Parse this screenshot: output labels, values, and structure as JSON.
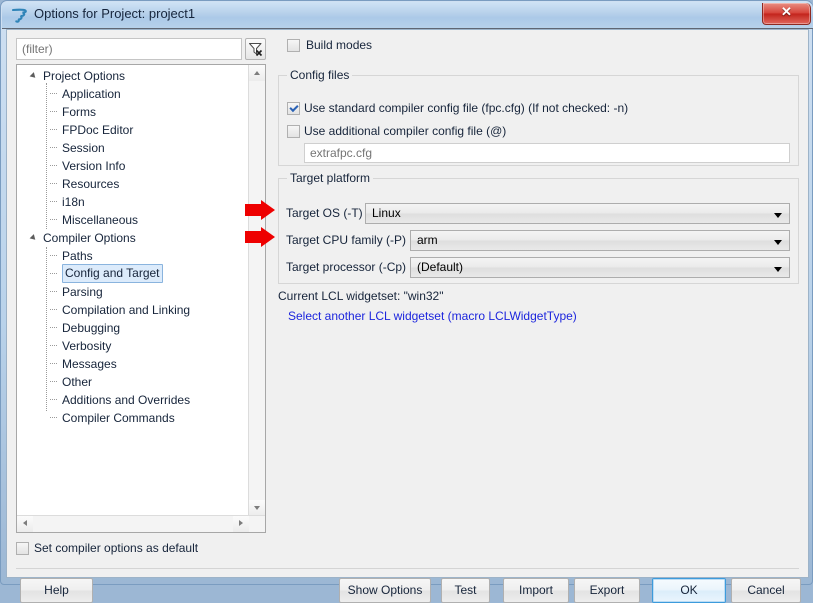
{
  "window": {
    "title": "Options for Project: project1",
    "app_icon": "lazarus-icon",
    "close_label": "✕"
  },
  "filter": {
    "placeholder": "(filter)",
    "value": "",
    "clear_icon": "filter-clear-icon"
  },
  "tree": {
    "items": [
      {
        "label": "Project Options",
        "level": 0,
        "expanded": true,
        "selected": false
      },
      {
        "label": "Application",
        "level": 1,
        "expanded": false,
        "selected": false
      },
      {
        "label": "Forms",
        "level": 1,
        "expanded": false,
        "selected": false
      },
      {
        "label": "FPDoc Editor",
        "level": 1,
        "expanded": false,
        "selected": false
      },
      {
        "label": "Session",
        "level": 1,
        "expanded": false,
        "selected": false
      },
      {
        "label": "Version Info",
        "level": 1,
        "expanded": false,
        "selected": false
      },
      {
        "label": "Resources",
        "level": 1,
        "expanded": false,
        "selected": false
      },
      {
        "label": "i18n",
        "level": 1,
        "expanded": false,
        "selected": false
      },
      {
        "label": "Miscellaneous",
        "level": 1,
        "expanded": false,
        "selected": false
      },
      {
        "label": "Compiler Options",
        "level": 0,
        "expanded": true,
        "selected": false
      },
      {
        "label": "Paths",
        "level": 1,
        "expanded": false,
        "selected": false
      },
      {
        "label": "Config and Target",
        "level": 1,
        "expanded": false,
        "selected": true
      },
      {
        "label": "Parsing",
        "level": 1,
        "expanded": false,
        "selected": false
      },
      {
        "label": "Compilation and Linking",
        "level": 1,
        "expanded": false,
        "selected": false
      },
      {
        "label": "Debugging",
        "level": 1,
        "expanded": false,
        "selected": false
      },
      {
        "label": "Verbosity",
        "level": 1,
        "expanded": false,
        "selected": false
      },
      {
        "label": "Messages",
        "level": 1,
        "expanded": false,
        "selected": false
      },
      {
        "label": "Other",
        "level": 1,
        "expanded": false,
        "selected": false
      },
      {
        "label": "Additions and Overrides",
        "level": 1,
        "expanded": false,
        "selected": false
      },
      {
        "label": "Compiler Commands",
        "level": 1,
        "expanded": false,
        "selected": false
      }
    ]
  },
  "main": {
    "build_modes": {
      "label": "Build modes",
      "checked": false
    },
    "config_files": {
      "title": "Config files",
      "use_standard": {
        "label": "Use standard compiler config file (fpc.cfg) (If not checked: -n)",
        "checked": true
      },
      "use_additional": {
        "label": "Use additional compiler config file (@)",
        "checked": false
      },
      "additional_path": {
        "value": "",
        "placeholder": "extrafpc.cfg"
      }
    },
    "target_platform": {
      "title": "Target platform",
      "target_os": {
        "label": "Target OS (-T)",
        "value": "Linux"
      },
      "target_cpu": {
        "label": "Target CPU family (-P)",
        "value": "arm"
      },
      "target_processor": {
        "label": "Target processor (-Cp)",
        "value": "(Default)"
      }
    },
    "widgetset": {
      "current": "Current LCL widgetset: \"win32\"",
      "link": "Select another LCL widgetset (macro LCLWidgetType)"
    },
    "annotations": [
      {
        "name": "arrow-target-os",
        "color": "#ee0000"
      },
      {
        "name": "arrow-target-cpu",
        "color": "#ee0000"
      }
    ]
  },
  "footer": {
    "set_default": {
      "label": "Set compiler options as default",
      "checked": false
    },
    "buttons": {
      "help": "Help",
      "show_options": "Show Options",
      "test": "Test",
      "import": "Import",
      "export": "Export",
      "ok": "OK",
      "cancel": "Cancel"
    }
  }
}
